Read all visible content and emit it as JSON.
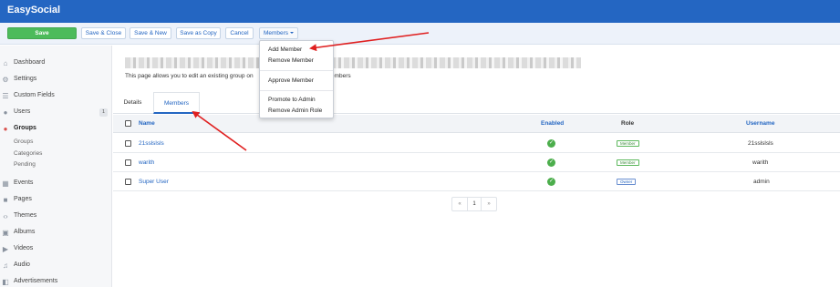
{
  "app": {
    "brand": "EasySocial"
  },
  "toolbar": {
    "save": "Save",
    "save_close": "Save & Close",
    "save_new": "Save & New",
    "save_copy": "Save as Copy",
    "cancel": "Cancel",
    "members": "Members"
  },
  "sidebar": {
    "items": [
      {
        "label": "Dashboard",
        "icon": "home-icon"
      },
      {
        "label": "Settings",
        "icon": "gears-icon"
      },
      {
        "label": "Custom Fields",
        "icon": "list-icon"
      },
      {
        "label": "Users",
        "icon": "users-icon",
        "badge": "1"
      },
      {
        "label": "Groups",
        "icon": "groups-icon"
      },
      {
        "label": "Events",
        "icon": "calendar-icon"
      },
      {
        "label": "Pages",
        "icon": "pages-icon"
      },
      {
        "label": "Themes",
        "icon": "code-icon"
      },
      {
        "label": "Albums",
        "icon": "album-icon"
      },
      {
        "label": "Videos",
        "icon": "video-icon"
      },
      {
        "label": "Audio",
        "icon": "music-icon"
      },
      {
        "label": "Advertisements",
        "icon": "ad-icon"
      }
    ],
    "groups_sub": [
      "Groups",
      "Categories",
      "Pending"
    ]
  },
  "page": {
    "description": "This page allows you to edit an existing group on",
    "description_tail": "embers"
  },
  "tabs": {
    "details": "Details",
    "members": "Members"
  },
  "table": {
    "headers": {
      "name": "Name",
      "enabled": "Enabled",
      "role": "Role",
      "username": "Username"
    },
    "rows": [
      {
        "name": "21sslslsls",
        "role": "Member",
        "username": "21sslslsls"
      },
      {
        "name": "warith",
        "role": "Member",
        "username": "warith"
      },
      {
        "name": "Super User",
        "role": "Owner",
        "username": "admin"
      }
    ]
  },
  "pagination": {
    "prev": "«",
    "page": "1",
    "next": "»"
  },
  "members_menu": {
    "add": "Add Member",
    "remove": "Remove Member",
    "approve": "Approve Member",
    "promote": "Promote to Admin",
    "remove_admin": "Remove Admin Role"
  },
  "colors": {
    "brand": "#2466c2",
    "save": "#4cbb5b",
    "annotation": "#e02020"
  }
}
